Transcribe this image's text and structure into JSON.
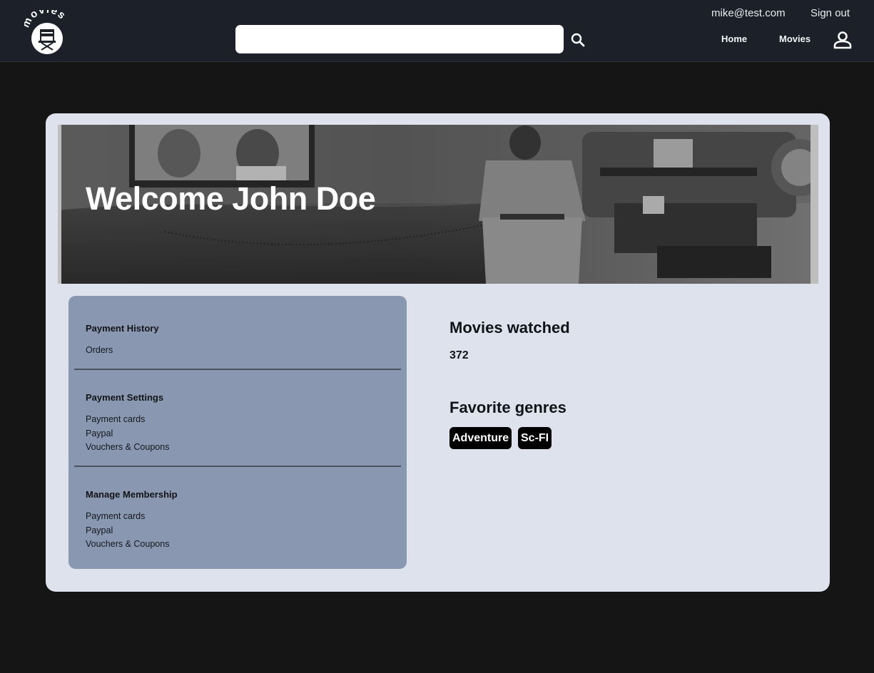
{
  "header": {
    "logo_text": "movies",
    "search": {
      "value": "",
      "placeholder": ""
    },
    "account_email": "mike@test.com",
    "signout_label": "Sign out",
    "nav": {
      "home": "Home",
      "movies": "Movies"
    }
  },
  "banner": {
    "title": "Welcome John Doe"
  },
  "sidebar": {
    "sections": [
      {
        "heading": "Payment History",
        "links": [
          "Orders"
        ]
      },
      {
        "heading": "Payment Settings",
        "links": [
          "Payment cards",
          "Paypal",
          "Vouchers & Coupons"
        ]
      },
      {
        "heading": "Manage Membership",
        "links": [
          "Payment cards",
          "Paypal",
          "Vouchers & Coupons"
        ]
      }
    ]
  },
  "stats": {
    "watched_heading": "Movies watched",
    "watched_value": "372",
    "genres_heading": "Favorite genres",
    "genres": [
      "Adventure",
      "Sc-FI"
    ]
  },
  "icons": {
    "logo": "director-chair-icon",
    "search": "search-icon",
    "profile": "person-icon"
  },
  "colors": {
    "header_bg": "#1b2029",
    "page_bg": "#151515",
    "card_bg": "#dde2ec",
    "sidebar_bg": "#8997b0",
    "chip_bg": "#000000"
  }
}
